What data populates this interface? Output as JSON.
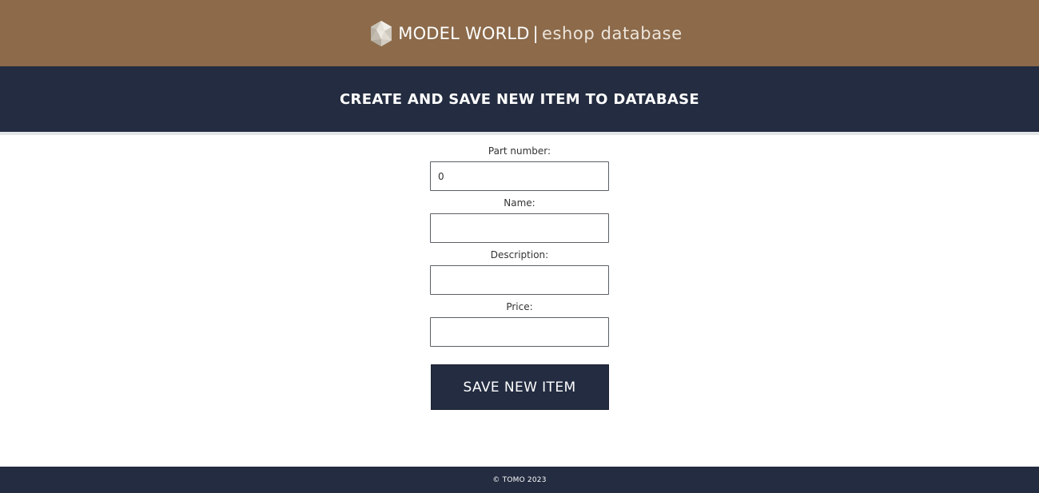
{
  "colors": {
    "header_bg": "#8c6a4a",
    "navy": "#232c40",
    "page_bg": "#ffffff"
  },
  "header": {
    "logo_icon": "faceted-gem-icon",
    "brand_main": "MODEL WORLD",
    "brand_separator": "|",
    "brand_sub": "eshop database"
  },
  "title_band": {
    "title": "CREATE AND SAVE NEW ITEM TO DATABASE"
  },
  "form": {
    "fields": [
      {
        "label": "Part number:",
        "value": "0",
        "placeholder": ""
      },
      {
        "label": "Name:",
        "value": "",
        "placeholder": ""
      },
      {
        "label": "Description:",
        "value": "",
        "placeholder": ""
      },
      {
        "label": "Price:",
        "value": "",
        "placeholder": ""
      }
    ],
    "save_label": "SAVE NEW ITEM"
  },
  "footer": {
    "copyright": "© TOMO 2023"
  }
}
